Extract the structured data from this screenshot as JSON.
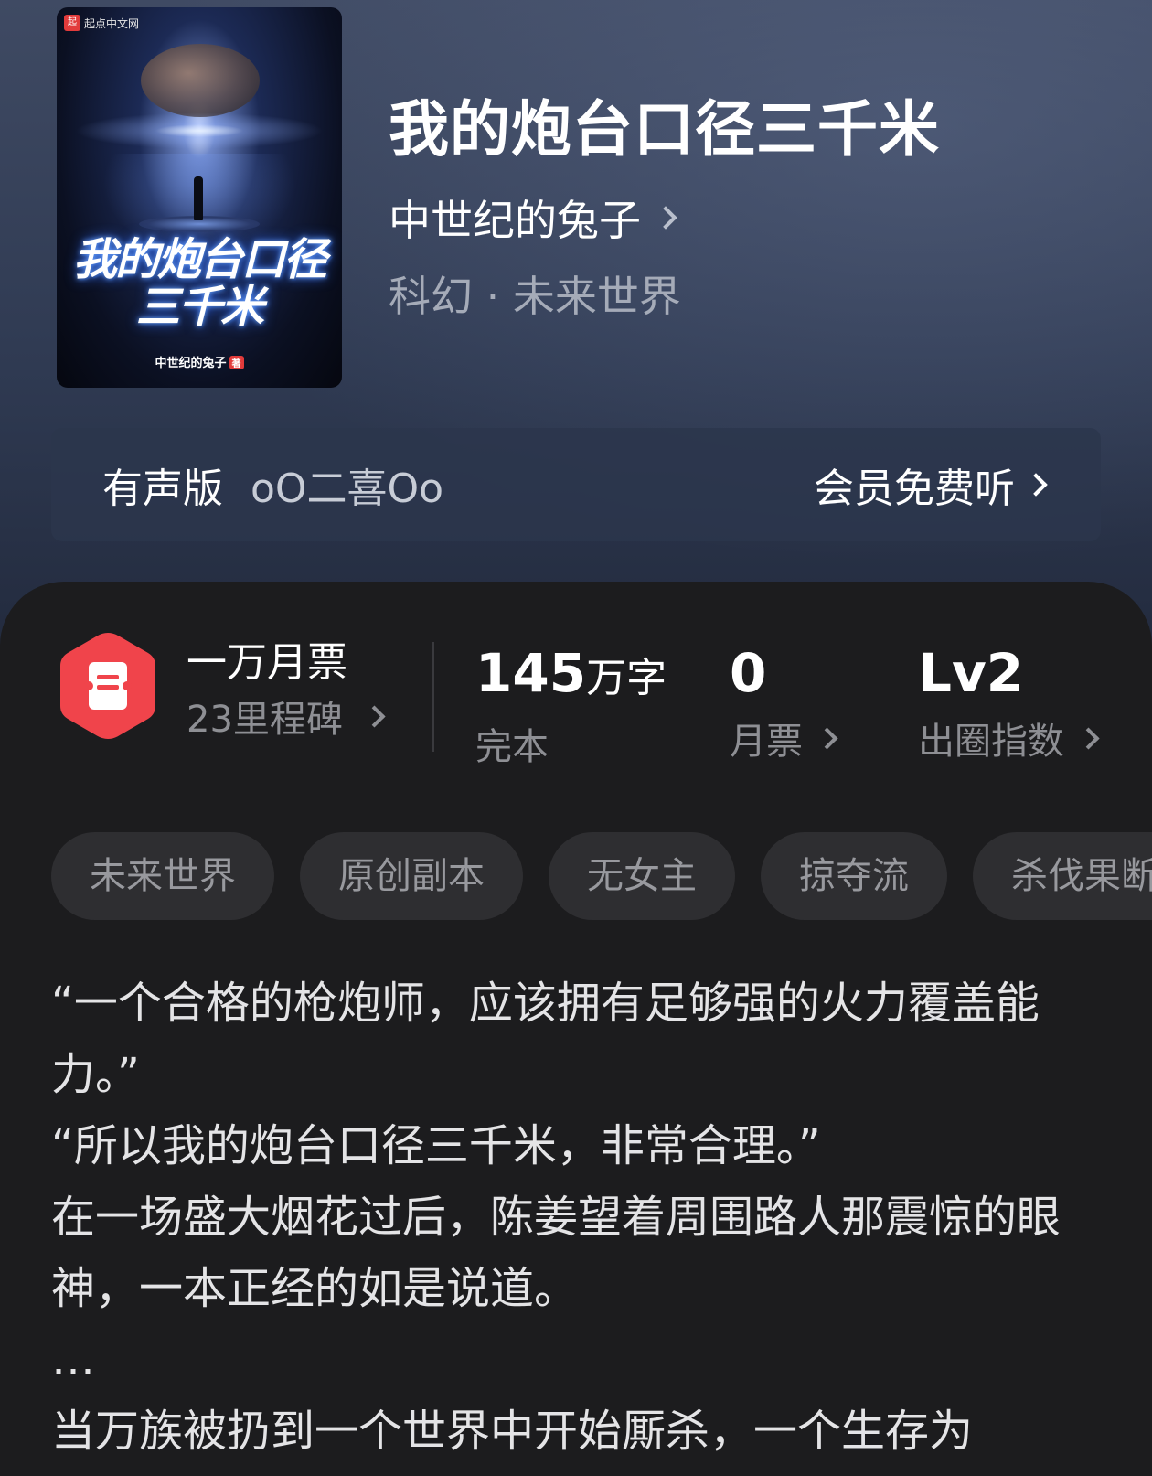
{
  "book": {
    "cover": {
      "publisher": "起点中文网",
      "title": "我的炮台口径三千米",
      "author": "中世纪的兔子",
      "author_mark": "著"
    },
    "title": "我的炮台口径三千米",
    "author": "中世纪的兔子",
    "genre": "科幻 · 未来世界"
  },
  "audio": {
    "label": "有声版",
    "narrator": "oO二喜Oo",
    "action": "会员免费听"
  },
  "milestone": {
    "title": "一万月票",
    "subtitle": "23里程碑"
  },
  "stats": {
    "words_value": "145",
    "words_unit": "万字",
    "words_label": "完本",
    "tickets_value": "0",
    "tickets_label": "月票",
    "level_value": "Lv2",
    "level_label": "出圈指数"
  },
  "tags": [
    "未来世界",
    "原创副本",
    "无女主",
    "掠夺流",
    "杀伐果断"
  ],
  "synopsis": "“一个合格的枪炮师，应该拥有足够强的火力覆盖能力。”\n“所以我的炮台口径三千米，非常合理。”\n在一场盛大烟花过后，陈姜望着周围路人那震惊的眼神，一本正经的如是说道。\n…\n当万族被扔到一个世界中开始厮杀，一个生存为",
  "colors": {
    "badge_red": "#f0444b",
    "sheet_bg": "#1c1c1e",
    "tag_bg": "#2e2e31",
    "header_bg": "#2f3a52"
  },
  "icons": {
    "milestone": "ticket-hexagon-icon",
    "chevron": "chevron-right-icon"
  }
}
